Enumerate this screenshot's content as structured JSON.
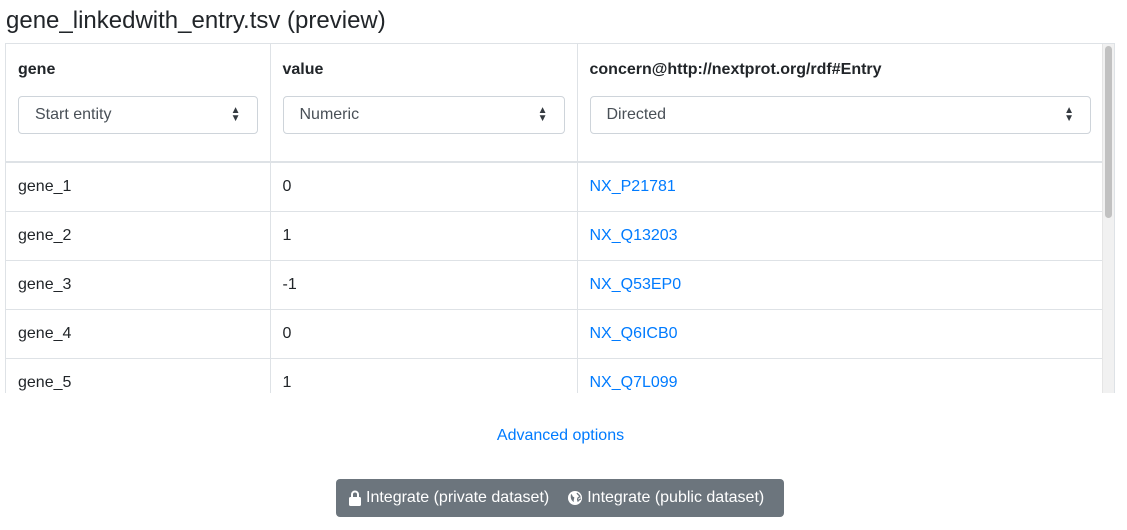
{
  "page": {
    "title": "gene_linkedwith_entry.tsv (preview)"
  },
  "table": {
    "columns": [
      {
        "header": "gene",
        "select_value": "Start entity"
      },
      {
        "header": "value",
        "select_value": "Numeric"
      },
      {
        "header": "concern@http://nextprot.org/rdf#Entry",
        "select_value": "Directed"
      }
    ],
    "rows": [
      {
        "gene": "gene_1",
        "value": "0",
        "entry": "NX_P21781"
      },
      {
        "gene": "gene_2",
        "value": "1",
        "entry": "NX_Q13203"
      },
      {
        "gene": "gene_3",
        "value": "-1",
        "entry": "NX_Q53EP0"
      },
      {
        "gene": "gene_4",
        "value": "0",
        "entry": "NX_Q6ICB0"
      },
      {
        "gene": "gene_5",
        "value": "1",
        "entry": "NX_Q7L099"
      }
    ]
  },
  "advanced_options_label": "Advanced options",
  "actions": {
    "private_label": "Integrate (private dataset)",
    "public_label": "Integrate (public dataset)",
    "private_icon": "lock-icon",
    "public_icon": "globe-icon"
  },
  "colors": {
    "link": "#007bff",
    "button": "#6c757d",
    "border": "#dee2e6"
  }
}
